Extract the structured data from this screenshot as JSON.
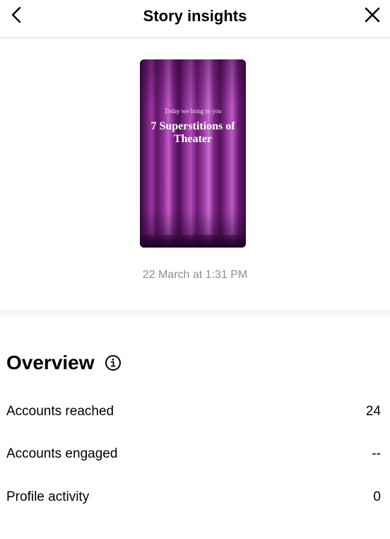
{
  "header": {
    "title": "Story insights",
    "back_icon": "chevron-left-icon",
    "close_icon": "close-icon"
  },
  "story": {
    "kicker": "Today we bring to you",
    "headline": "7 Superstitions of Theater",
    "date": "22 March at 1:31 PM"
  },
  "overview": {
    "title": "Overview",
    "info_icon": "info-icon",
    "metrics": [
      {
        "label": "Accounts reached",
        "value": "24"
      },
      {
        "label": "Accounts engaged",
        "value": "--"
      },
      {
        "label": "Profile activity",
        "value": "0"
      }
    ]
  }
}
